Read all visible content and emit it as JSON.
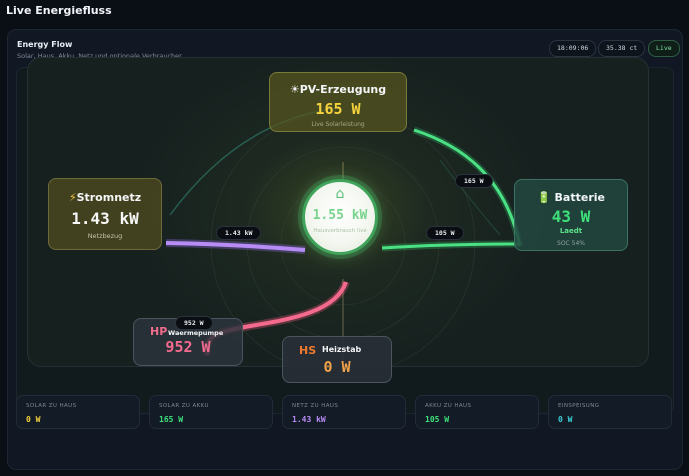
{
  "page": {
    "title": "Live Energiefluss"
  },
  "card": {
    "title": "Energy Flow",
    "subtitle": "Solar, Haus, Akku, Netz und optionale Verbraucher",
    "time": "18:09:06",
    "price": "35.38 ct",
    "status": "Live"
  },
  "nodes": {
    "pv": {
      "icon": "sun-icon",
      "icon_glyph": "☀",
      "label": "PV-Erzeugung",
      "value": "165 W",
      "sub": "Live Solarleistung",
      "color": "#f5d33c"
    },
    "grid": {
      "icon": "lightning-icon",
      "icon_glyph": "⚡",
      "label": "Stromnetz",
      "value": "1.43 kW",
      "sub": "Netzbezug"
    },
    "battery": {
      "icon": "battery-icon",
      "icon_glyph": "🔋",
      "label": "Batterie",
      "value": "43 W",
      "state": "Laedt",
      "sub": "SOC 54%",
      "color": "#3ee07a"
    },
    "house": {
      "icon": "house-icon",
      "icon_glyph": "⌂",
      "value": "1.55 kW",
      "label": "Hausverbrauch live"
    },
    "heatpump": {
      "abbr": "HP",
      "label": "Waermepumpe",
      "value": "952 W",
      "color": "#f26a8d"
    },
    "heater": {
      "abbr": "HS",
      "label": "Heizstab",
      "value": "0 W",
      "color": "#f07a2c"
    }
  },
  "flows": {
    "pv_to_battery": "165 W",
    "grid_to_house": "1.43 kW",
    "battery_flow": "105 W",
    "house_to_heatpump": "952 W"
  },
  "stats": [
    {
      "label": "SOLAR ZU HAUS",
      "value": "0 W",
      "color": "#f5d33c"
    },
    {
      "label": "SOLAR ZU AKKU",
      "value": "165 W",
      "color": "#3ee07a"
    },
    {
      "label": "NETZ ZU HAUS",
      "value": "1.43 kW",
      "color": "#b78cf5"
    },
    {
      "label": "AKKU ZU HAUS",
      "value": "105 W",
      "color": "#3ee07a"
    },
    {
      "label": "EINSPEISUNG",
      "value": "0 W",
      "color": "#3ccfd6"
    }
  ]
}
